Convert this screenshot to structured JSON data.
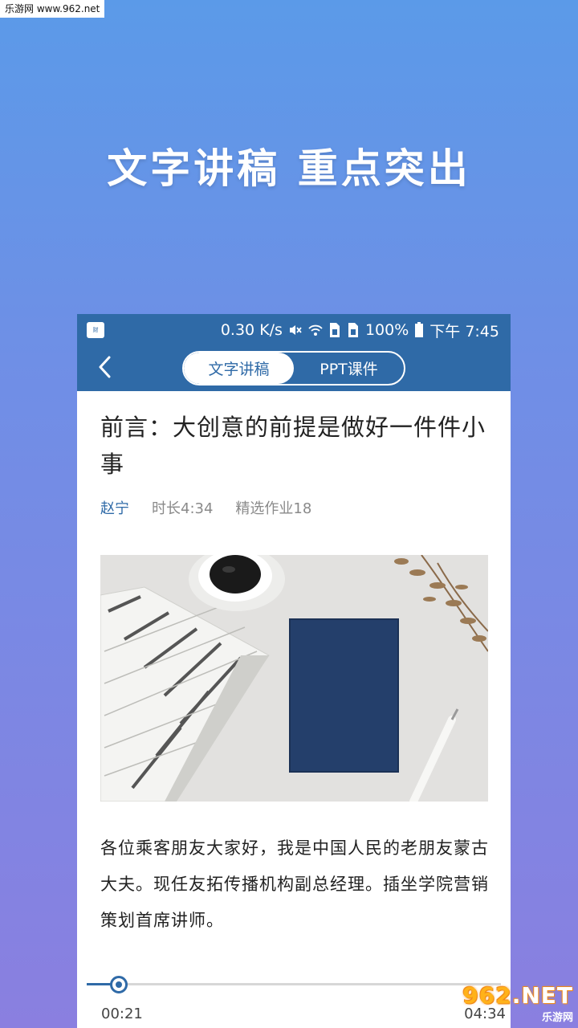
{
  "watermark": {
    "top_text": "乐游网 www.962.net",
    "bottom_logo_prefix": "962",
    "bottom_logo_suffix": ".NET",
    "bottom_sub": "乐游网"
  },
  "promo": {
    "headline": "文字讲稿 重点突出"
  },
  "statusbar": {
    "speed": "0.30 K/s",
    "battery": "100%",
    "time": "下午 7:45",
    "icons": [
      "mute-icon",
      "wifi-icon",
      "sim-icon",
      "sim-icon",
      "battery-icon"
    ]
  },
  "nav": {
    "back_icon": "chevron-left-icon",
    "tabs": [
      {
        "label": "文字讲稿",
        "active": true
      },
      {
        "label": "PPT课件",
        "active": false
      }
    ]
  },
  "article": {
    "title": "前言：大创意的前提是做好一件件小事",
    "author": "赵宁",
    "duration": "时长4:34",
    "homework": "精选作业18",
    "body": "各位乘客朋友大家好，我是中国人民的老朋友蒙古大夫。现任友拓传播机构副总经理。插坐学院营销策划首席讲师。"
  },
  "player": {
    "current_time": "00:21",
    "total_time": "04:34",
    "progress": 0.077
  },
  "colors": {
    "accent": "#2f6aa7",
    "bg_top": "#5b9ae8",
    "bg_bottom": "#8a7fe0"
  }
}
